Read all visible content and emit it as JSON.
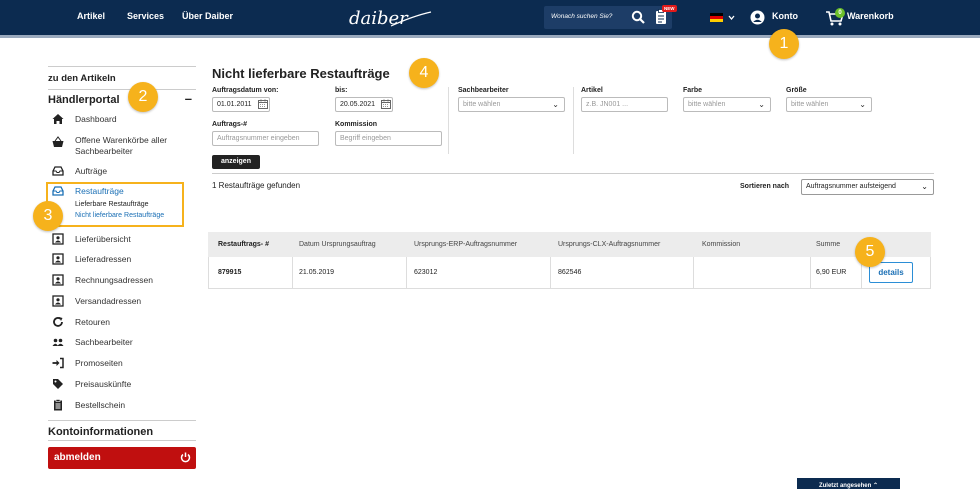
{
  "header": {
    "nav": [
      "Artikel",
      "Services",
      "Über Daiber"
    ],
    "logo_text": "daiber",
    "search": {
      "placeholder": "Wonach suchen Sie?"
    },
    "new_badge": "NEW",
    "account_label": "Konto",
    "cart_label": "Warenkorb",
    "cart_count": "0"
  },
  "markers": [
    "1",
    "2",
    "3",
    "4",
    "5"
  ],
  "sidebar": {
    "back_link": "zu den Artikeln",
    "section_title": "Händlerportal",
    "collapse_symbol": "–",
    "items": [
      {
        "label": "Dashboard",
        "icon": "home-icon"
      },
      {
        "label": "Offene Warenkörbe aller Sachbearbeiter",
        "icon": "basket-icon"
      },
      {
        "label": "Aufträge",
        "icon": "inbox-icon"
      },
      {
        "label": "Restaufträge",
        "icon": "inbox-icon",
        "active": true
      },
      {
        "label": "Lieferübersicht",
        "icon": "contact-card-icon"
      },
      {
        "label": "Lieferadressen",
        "icon": "contact-card-icon"
      },
      {
        "label": "Rechnungsadressen",
        "icon": "contact-card-icon"
      },
      {
        "label": "Versandadressen",
        "icon": "contact-card-icon"
      },
      {
        "label": "Retouren",
        "icon": "refresh-icon"
      },
      {
        "label": "Sachbearbeiter",
        "icon": "users-icon"
      },
      {
        "label": "Promoseiten",
        "icon": "sign-in-icon"
      },
      {
        "label": "Preisauskünfte",
        "icon": "price-tag-icon"
      },
      {
        "label": "Bestellschein",
        "icon": "clipboard-icon"
      }
    ],
    "subitems": [
      "Lieferbare Restaufträge",
      "Nicht lieferbare Restaufträge"
    ],
    "account_section": "Kontoinformationen",
    "logout_label": "abmelden"
  },
  "main": {
    "title": "Nicht lieferbare Restaufträge",
    "filters": {
      "date_from_label": "Auftragsdatum von:",
      "date_from_value": "01.01.2011",
      "date_to_label": "bis:",
      "date_to_value": "20.05.2021",
      "order_no_label": "Auftrags-#",
      "order_no_placeholder": "Auftragsnummer eingeben",
      "commission_label": "Kommission",
      "commission_placeholder": "Begriff eingeben",
      "clerk_label": "Sachbearbeiter",
      "clerk_value": "bitte wählen",
      "article_label": "Artikel",
      "article_placeholder": "z.B. JN001 ...",
      "color_label": "Farbe",
      "color_value": "bitte wählen",
      "size_label": "Größe",
      "size_value": "bitte wählen",
      "submit_label": "anzeigen"
    },
    "results_count": "1 Restaufträge gefunden",
    "sort_label": "Sortieren nach",
    "sort_value": "Auftragsnummer aufsteigend",
    "table": {
      "headers": [
        "Restauftrags- #",
        "Datum Ursprungsauftrag",
        "Ursprungs-ERP-Auftragsnummer",
        "Ursprungs-CLX-Auftragsnummer",
        "Kommission",
        "Summe"
      ],
      "rows": [
        {
          "order": "879915",
          "date": "21.05.2019",
          "erp": "623012",
          "clx": "862546",
          "commission": "",
          "sum": "6,90 EUR",
          "action": "details"
        }
      ]
    },
    "recently_viewed": "Zuletzt angesehen"
  },
  "colors": {
    "header_bg": "#0c2b50",
    "marker": "#f6b21c",
    "logout": "#c00f0f",
    "link": "#1a6fb5"
  }
}
